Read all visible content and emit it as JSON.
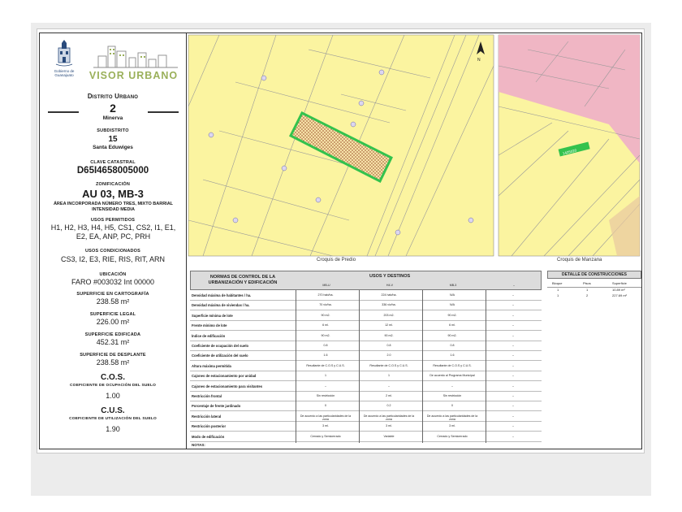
{
  "logo": {
    "municipality_text": "Gobierno de Guanajuato",
    "brand": "VISOR URBANO"
  },
  "distrito": {
    "label": "Distrito Urbano",
    "number": "2",
    "name": "Minerva"
  },
  "subdistrito": {
    "label": "SUBDISTRITO",
    "number": "15",
    "name": "Santa Eduwiges"
  },
  "clave": {
    "label": "CLAVE CATASTRAL",
    "value": "D65I4658005000"
  },
  "zonificacion": {
    "label": "ZONIFICACIÓN",
    "value": "AU 03, MB-3",
    "desc": "ÁREA INCORPORADA NÚMERO TRES, MIXTO BARRIAL INTENSIDAD MEDIA"
  },
  "usos_permitidos": {
    "label": "USOS PERMITIDOS",
    "value": "H1, H2, H3, H4, H5, CS1, CS2, I1, E1, E2, EA, ANP, PC, PRH"
  },
  "usos_condicionados": {
    "label": "USOS CONDICIONADOS",
    "value": "CS3, I2, E3, RIE, RIS, RIT, ARN"
  },
  "ubicacion": {
    "label": "UBICACIÓN",
    "value": "FARO #003032 Int 00000"
  },
  "sup_cartografia": {
    "label": "SUPERFICIE EN CARTOGRAFÍA",
    "value": "238.58 m²"
  },
  "sup_legal": {
    "label": "SUPERFICIE LEGAL",
    "value": "226.00 m²"
  },
  "sup_edificada": {
    "label": "SUPERFICIE EDIFICADA",
    "value": "452.31 m²"
  },
  "sup_desplante": {
    "label": "SUPERFICIE DE DESPLANTE",
    "value": "238.58 m²"
  },
  "cos": {
    "title": "C.O.S.",
    "label": "COEFICIENTE DE OCUPACIÓN DEL SUELO",
    "value": "1.00"
  },
  "cus": {
    "title": "C.U.S.",
    "label": "COEFICIENTE DE UTILIZACIÓN DEL SUELO",
    "value": "1.90"
  },
  "maps": {
    "predio_caption": "Croquis de Predio",
    "manzana_caption": "Croquis de Manzana",
    "north": "N",
    "lot_label": "1425020"
  },
  "normas": {
    "header_left": "NORMAS DE CONTROL DE LA URBANIZACIÓN Y EDIFICACIÓN",
    "header_right": "USOS Y DESTINOS",
    "columns": [
      "MB-U",
      "H4-V",
      "MB-3",
      "–"
    ],
    "rows": [
      {
        "name": "Densidad máxima de habitantes / ha.",
        "vals": [
          "270 hab/ha.",
          "224 hab/ha.",
          "N/A",
          "–"
        ]
      },
      {
        "name": "Densidad máxima de viviendas / ha.",
        "vals": [
          "70 viv/ha.",
          "336 viv/ha.",
          "N/A",
          "–"
        ]
      },
      {
        "name": "Superficie mínima de lote",
        "vals": [
          "90 m2.",
          "203 m2.",
          "90 m2.",
          "–"
        ]
      },
      {
        "name": "Frente mínimo de lote",
        "vals": [
          "6 ml.",
          "12 ml.",
          "6 ml.",
          "–"
        ]
      },
      {
        "name": "Índice de edificación",
        "vals": [
          "90 m2.",
          "90 m2.",
          "90 m2.",
          "–"
        ]
      },
      {
        "name": "Coeficiente de ocupación del suelo",
        "vals": [
          "0.8",
          "0.8",
          "0.8",
          "–"
        ]
      },
      {
        "name": "Coeficiente de utilización del suelo",
        "vals": [
          "1.6",
          "2.0",
          "1.6",
          "–"
        ]
      },
      {
        "name": "Altura máxima permitida",
        "vals": [
          "Resultante de C.O.S y C.U.S.",
          "Resultante de C.O.S y C.U.S.",
          "Resultante de C.O.S y C.U.S.",
          "–"
        ]
      },
      {
        "name": "Cajones de estacionamiento por unidad",
        "vals": [
          "1",
          "1",
          "De acuerdo al Programa Municipal",
          "–"
        ]
      },
      {
        "name": "Cajones de estacionamiento para visitantes",
        "vals": [
          "–",
          "–",
          "–",
          "–"
        ]
      },
      {
        "name": "Restricción frontal",
        "vals": [
          "Sin restricción",
          "2 ml.",
          "Sin restricción",
          "–"
        ]
      },
      {
        "name": "Porcentaje de frente jardinado",
        "vals": [
          "0",
          "0.2",
          "0",
          "–"
        ]
      },
      {
        "name": "Restricción lateral",
        "vals": [
          "De acuerdo a las particularidades de la zona",
          "De acuerdo a las particularidades de la zona",
          "De acuerdo a las particularidades de la zona",
          "–"
        ]
      },
      {
        "name": "Restricción posterior",
        "vals": [
          "3 ml.",
          "3 ml.",
          "3 ml.",
          "–"
        ]
      },
      {
        "name": "Modo de edificación",
        "vals": [
          "Cerrado y Semicerrado",
          "Variable",
          "Cerrado y Semicerrado",
          "–"
        ]
      }
    ],
    "notas": "NOTAS:"
  },
  "detalle": {
    "title": "DETALLE DE CONSTRUCCIONES",
    "columns": [
      "Bloque",
      "Pisos",
      "Superficie"
    ],
    "rows": [
      [
        "1",
        "1",
        "10.89 m²"
      ],
      [
        "1",
        "2",
        "227.69 m²"
      ]
    ]
  },
  "colors": {
    "map_yellow": "#fbf4a0",
    "map_pink": "#f0b6c4",
    "lot_green": "#33c24d",
    "brand_green": "#9ab05a"
  }
}
